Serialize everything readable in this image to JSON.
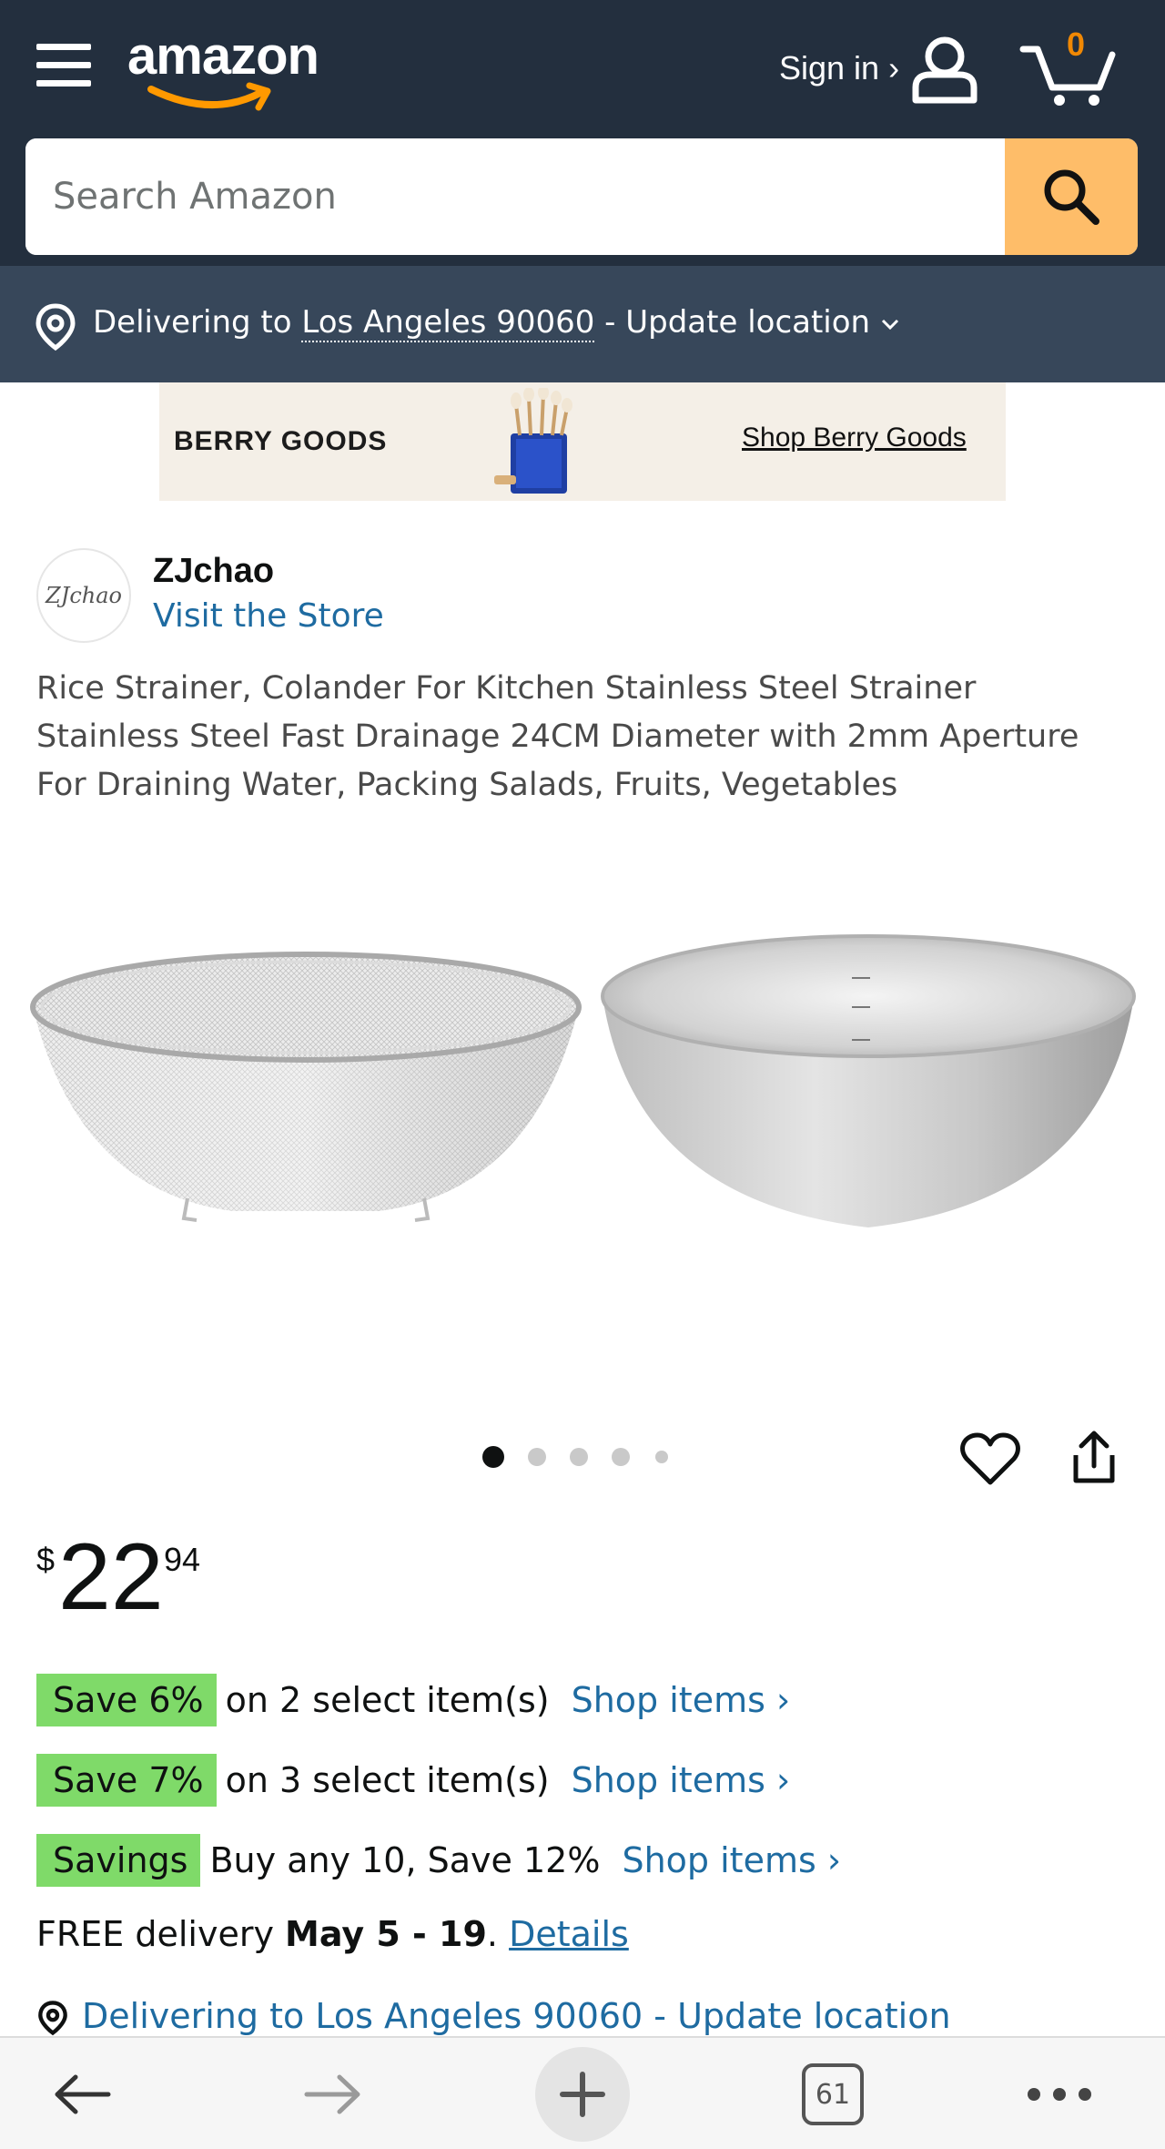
{
  "header": {
    "logo_text": "amazon",
    "signin_label": "Sign in ›",
    "cart_count": "0",
    "search_placeholder": "Search Amazon"
  },
  "location_bar": {
    "prefix": "Delivering to ",
    "location": "Los Angeles 90060",
    "suffix": " - Update location"
  },
  "banner": {
    "brand": "BERRY GOODS",
    "link": "Shop Berry Goods"
  },
  "store": {
    "logo_text": "ZJchao",
    "name": "ZJchao",
    "link": "Visit the Store"
  },
  "product": {
    "title": "Rice Strainer, Colander For Kitchen Stainless Steel Strainer Stainless Steel Fast Drainage 24CM Diameter with 2mm Aperture For Draining Water, Packing Salads, Fruits, Vegetables",
    "image_count": 5,
    "active_image": 1
  },
  "price": {
    "currency": "$",
    "whole": "22",
    "fraction": "94"
  },
  "promotions": [
    {
      "badge": "Save 6%",
      "text": "on 2 select item(s)",
      "link": "Shop items ›"
    },
    {
      "badge": "Save 7%",
      "text": "on 3 select item(s)",
      "link": "Shop items ›"
    },
    {
      "badge": "Savings",
      "text": "Buy any 10, Save 12%",
      "link": "Shop items ›"
    }
  ],
  "delivery": {
    "prefix": "FREE delivery ",
    "dates": "May 5 - 19",
    "after": ". ",
    "details": "Details",
    "location_line": "Delivering to Los Angeles 90060 - Update location"
  },
  "browser_nav": {
    "tab_count": "61"
  },
  "colors": {
    "header_bg": "#232f3e",
    "location_bg": "#37475a",
    "search_button": "#febd69",
    "link": "#1e6ba1",
    "badge_green": "#7fda69",
    "cart_count": "#f08804"
  }
}
